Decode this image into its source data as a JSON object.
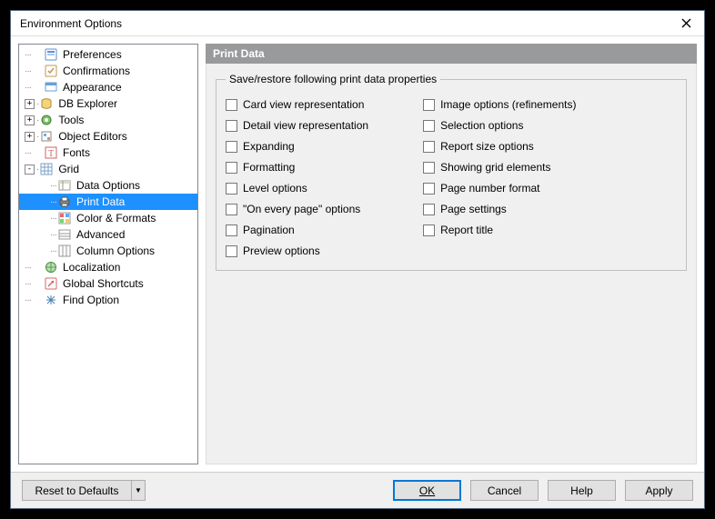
{
  "window": {
    "title": "Environment Options"
  },
  "tree": {
    "preferences": "Preferences",
    "confirmations": "Confirmations",
    "appearance": "Appearance",
    "db_explorer": "DB Explorer",
    "tools": "Tools",
    "object_editors": "Object Editors",
    "fonts": "Fonts",
    "grid": "Grid",
    "grid_children": {
      "data_options": "Data Options",
      "print_data": "Print Data",
      "color_formats": "Color & Formats",
      "advanced": "Advanced",
      "column_options": "Column Options"
    },
    "localization": "Localization",
    "global_shortcuts": "Global Shortcuts",
    "find_option": "Find Option"
  },
  "panel": {
    "title": "Print Data",
    "group_title": "Save/restore following print data properties",
    "left": [
      "Card view representation",
      "Detail view representation",
      "Expanding",
      "Formatting",
      "Level options",
      "\"On every page\" options",
      "Pagination",
      "Preview options"
    ],
    "right": [
      "Image options (refinements)",
      "Selection options",
      "Report size options",
      "Showing grid elements",
      "Page number format",
      "Page settings",
      "Report title"
    ]
  },
  "buttons": {
    "reset": "Reset to Defaults",
    "ok": "OK",
    "cancel": "Cancel",
    "help": "Help",
    "apply": "Apply"
  }
}
